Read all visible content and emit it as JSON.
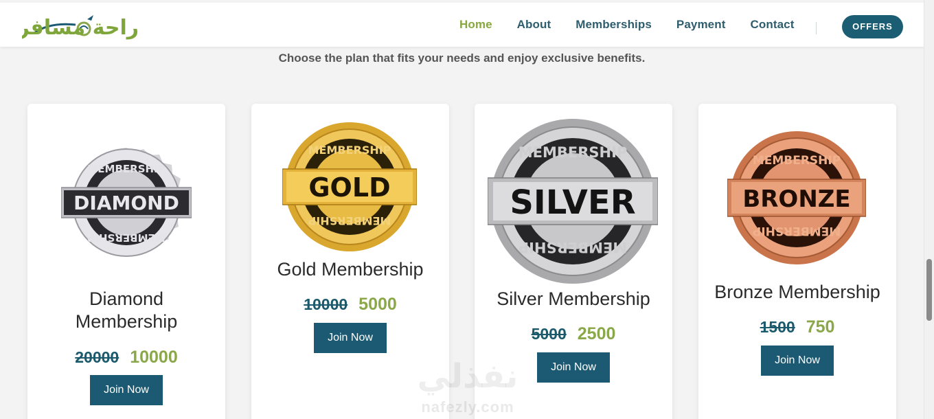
{
  "header": {
    "logo_text": "راحة مسافر",
    "nav": [
      "Home",
      "About",
      "Memberships",
      "Payment",
      "Contact"
    ],
    "active_nav": "Home",
    "offers_label": "OFFERS"
  },
  "subtitle": "Choose the plan that fits your needs and enjoy exclusive benefits.",
  "plans": [
    {
      "title_line1": "Diamond",
      "title_line2": "Membership",
      "badge_word": "DIAMOND",
      "badge_ring": "MEMBERSHIP",
      "old_price": "20000",
      "new_price": "10000",
      "button": "Join Now"
    },
    {
      "title_line1": "Gold Membership",
      "badge_word": "GOLD",
      "badge_ring": "MEMBERSHIP",
      "old_price": "10000",
      "new_price": "5000",
      "button": "Join Now"
    },
    {
      "title_line1": "Silver Membership",
      "badge_word": "SILVER",
      "badge_ring": "MEMBERSHIP",
      "old_price": "5000",
      "new_price": "2500",
      "button": "Join Now"
    },
    {
      "title_line1": "Bronze Membership",
      "badge_word": "BRONZE",
      "badge_ring": "MEMBERSHIP",
      "old_price": "1500",
      "new_price": "750",
      "button": "Join Now"
    }
  ],
  "watermark": {
    "arabic": "نفذلي",
    "latin": "nafezly.com"
  },
  "colors": {
    "brand": "#1b5a72",
    "accent_green": "#8aa84a",
    "nav_text": "#2e5e6e",
    "diamond": "#c9c9cd",
    "gold": "#e2b13a",
    "silver": "#b9b9b9",
    "bronze": "#d98a5e"
  }
}
